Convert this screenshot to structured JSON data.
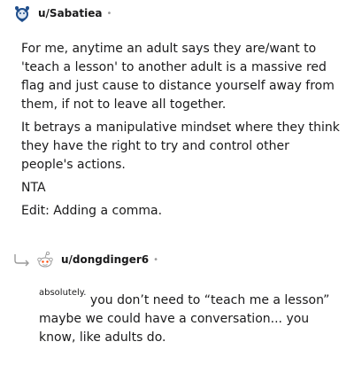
{
  "comments": [
    {
      "username": "u/Sabatiea",
      "separator": "•",
      "paragraphs": [
        "For me, anytime an adult says they are/want to 'teach a lesson' to another adult is a massive red flag and just cause to distance yourself away from them, if not to leave all together.",
        "It betrays a manipulative mindset where they think they have the right to try and control other people's actions.",
        "NTA",
        "Edit: Adding a comma."
      ]
    },
    {
      "username": "u/dongdinger6",
      "separator": "•",
      "superscript": "absolutely.",
      "body": " you don’t need to “teach me a lesson” maybe we could have a conversation... you know, like adults do."
    }
  ],
  "icons": {
    "avatar1": "snoo-avatar-icon",
    "avatar2": "snoo-default-avatar-icon",
    "reply": "reply-arrow-icon"
  },
  "colors": {
    "avatar_blue": "#1f4e8c",
    "snoo_red": "#ff4500",
    "gray": "#9a9a9a"
  }
}
